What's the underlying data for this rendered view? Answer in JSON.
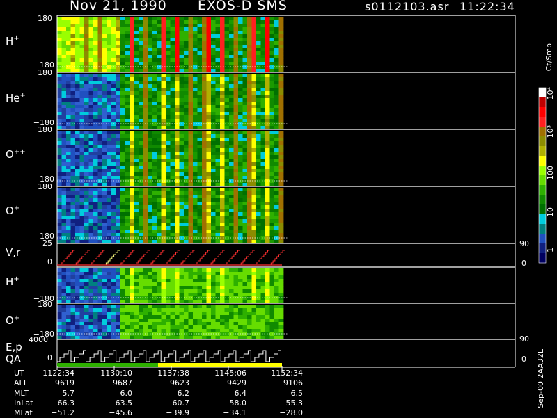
{
  "header": {
    "date": "Nov 21, 1990",
    "instrument": "EXOS-D SMS",
    "file": "s0112103.asr",
    "time": "11:22:34"
  },
  "panels": [
    {
      "ion": "H",
      "charge": "+",
      "top": "180",
      "bottom": "−180"
    },
    {
      "ion": "He",
      "charge": "+",
      "top": "180",
      "bottom": "−180"
    },
    {
      "ion": "O",
      "charge": "++",
      "top": "180",
      "bottom": "−180"
    },
    {
      "ion": "O",
      "charge": "+",
      "top": "180",
      "bottom": "−180"
    },
    {
      "ion": "V,r",
      "charge": "",
      "top": "25",
      "bottom": "0",
      "right_top": "90",
      "right_bottom": "0"
    },
    {
      "ion": "H",
      "charge": "+",
      "top": "180",
      "bottom": "−180"
    },
    {
      "ion": "O",
      "charge": "+",
      "top": "180",
      "bottom": "−180"
    },
    {
      "ion": "E,p",
      "charge": "",
      "ion2": "QA",
      "top": "4000",
      "bottom": "0",
      "right_top": "90",
      "right_bottom": "0"
    }
  ],
  "colorbar": {
    "unit": "Ct/Smp",
    "labels": [
      "10⁴",
      "10³",
      "100",
      "10",
      "1"
    ],
    "colors": [
      "#ffffff",
      "#c00000",
      "#ff0000",
      "#ff2020",
      "#a07000",
      "#8c8c00",
      "#b0b000",
      "#ffff00",
      "#9aff00",
      "#66dd00",
      "#2eb000",
      "#108a00",
      "#007000",
      "#00ccdd",
      "#008080",
      "#2050c0",
      "#102080",
      "#000060"
    ]
  },
  "side_label": "Sep-00 2AA32L",
  "table": {
    "row_labels": [
      "UT",
      "ALT",
      "MLT",
      "InLat",
      "MLat"
    ],
    "columns": [
      [
        "1122:34",
        "9619",
        "5.7",
        "66.3",
        "−51.2"
      ],
      [
        "1130:10",
        "9687",
        "6.0",
        "63.5",
        "−45.6"
      ],
      [
        "1137:38",
        "9623",
        "6.2",
        "60.7",
        "−39.9"
      ],
      [
        "1145:06",
        "9429",
        "6.4",
        "58.0",
        "−34.1"
      ],
      [
        "1152:34",
        "9106",
        "6.5",
        "55.3",
        "−28.0"
      ]
    ]
  },
  "chart_data": {
    "type": "heatmap",
    "title": "Nov 21, 1990   EXOS-D SMS",
    "x_ticks": [
      "1122:34",
      "1130:10",
      "1137:38",
      "1145:06",
      "1152:34"
    ],
    "panels": [
      "H+",
      "He+",
      "O++",
      "O+",
      "V,r",
      "H+",
      "O+",
      "E,p QA"
    ],
    "y_range_pitch": [
      -180,
      180
    ],
    "colorbar_range": [
      1,
      10000
    ],
    "colorbar_scale": "log",
    "energy_sweeps": 15
  }
}
